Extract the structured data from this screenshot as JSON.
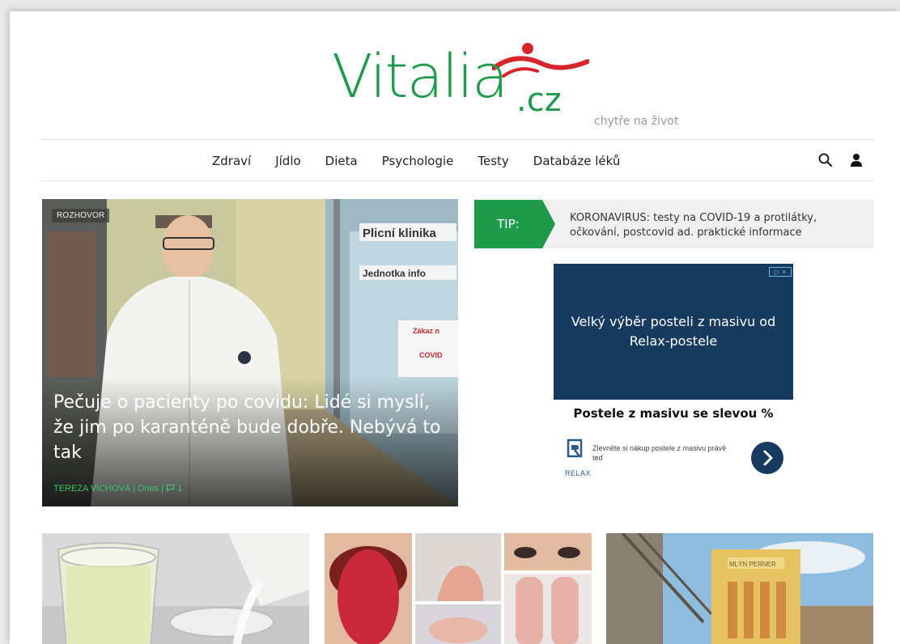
{
  "header": {
    "logo_main": "Vitalia",
    "logo_tld": "cz",
    "tagline": "chytře na život"
  },
  "nav": {
    "items": [
      "Zdraví",
      "Jídlo",
      "Dieta",
      "Psychologie",
      "Testy",
      "Databáze léků"
    ],
    "icons": [
      "search-icon",
      "user-icon"
    ]
  },
  "hero": {
    "label": "ROZHOVOR",
    "title": "Pečuje o pacienty po covidu: Lidé si myslí, že jim po karanténě bude dobře. Nebývá to tak",
    "author": "TEREZA VÍCHOVÁ",
    "date": "Dnes",
    "comments": "1",
    "sign_top": "Plicní klinika",
    "sign_mid": "Jednotka info",
    "sign_warn": "Zákaz n",
    "sign_covid": "COVID"
  },
  "tip": {
    "badge": "TIP:",
    "text": "KORONAVIRUS: testy na COVID-19 a protilátky, očkování, postcovid ad. praktické informace"
  },
  "ad": {
    "choices": "▷ ×",
    "banner_text": "Velký výběr posteli z masivu od Relax-postele",
    "headline": "Postele z masivu se slevou %",
    "subtext": "Zlevněte si nákup postele z masivu právě teď",
    "brand": "RELAX"
  },
  "thumbs": {
    "building_sign": "MLÝN PERNER"
  },
  "colors": {
    "brand_green": "#1e9a4a",
    "brand_red": "#d4262c",
    "ad_navy": "#163b5e",
    "meta_green": "#3ec56a"
  }
}
